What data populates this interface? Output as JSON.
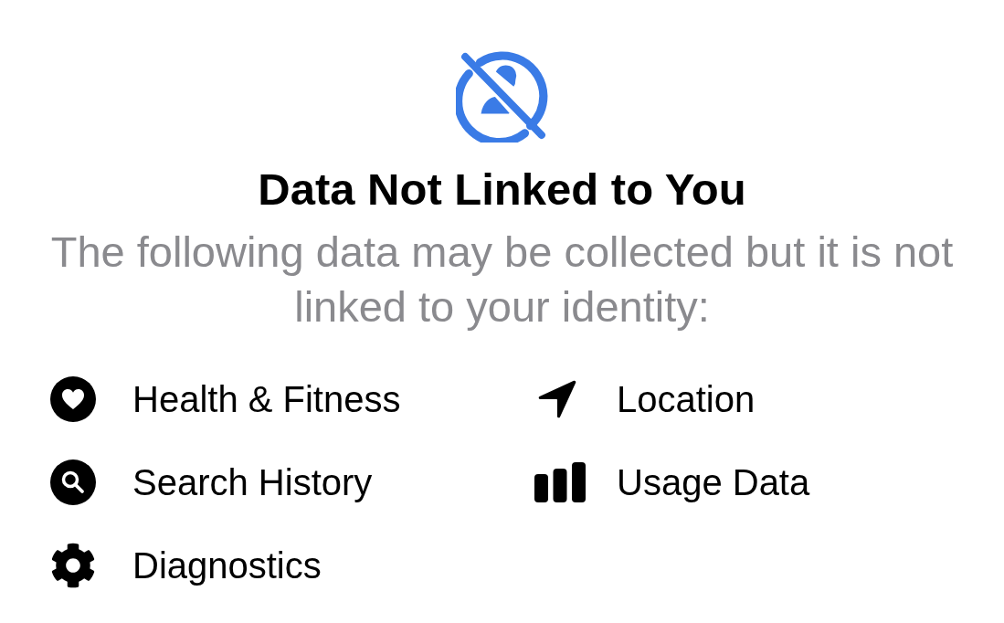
{
  "header": {
    "title": "Data Not Linked to You",
    "description": "The following data may be collected but it is not linked to your identity:"
  },
  "items": [
    {
      "kind": "heart",
      "label": "Health & Fitness"
    },
    {
      "kind": "location",
      "label": "Location"
    },
    {
      "kind": "search",
      "label": "Search History"
    },
    {
      "kind": "usage",
      "label": "Usage Data"
    },
    {
      "kind": "gear",
      "label": "Diagnostics"
    }
  ]
}
